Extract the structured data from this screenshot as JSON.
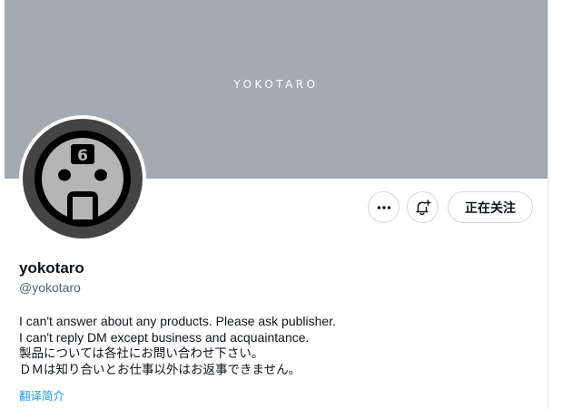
{
  "banner": {
    "text": "YOKOTARO",
    "color": "#a3aab1"
  },
  "avatar": {
    "icon": "yokotaro-mask-avatar"
  },
  "actions": {
    "more_icon": "more-horizontal-icon",
    "notify_icon": "bell-plus-icon",
    "follow_label": "正在关注"
  },
  "profile": {
    "name": "yokotaro",
    "handle": "@yokotaro",
    "bio_lines": [
      "I can't answer about any products. Please ask publisher.",
      "I can't reply DM except business and acquaintance.",
      "製品については各社にお問い合わせ下さい。",
      "ＤＭは知り合いとお仕事以外はお返事できません。"
    ],
    "translate_label": "翻译简介"
  },
  "colors": {
    "accent": "#1d9bf0",
    "text": "#0f1419",
    "muted": "#536471"
  }
}
